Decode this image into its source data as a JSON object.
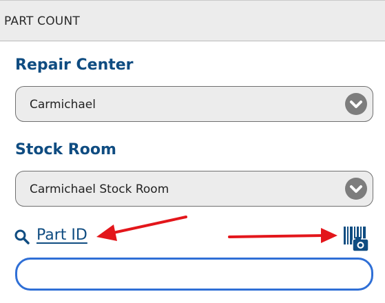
{
  "header": {
    "title": "PART COUNT"
  },
  "repair_center": {
    "label": "Repair Center",
    "selected": "Carmichael"
  },
  "stock_room": {
    "label": "Stock Room",
    "selected": "Carmichael Stock Room"
  },
  "part": {
    "label": "Part ID",
    "search_icon": "search-icon",
    "scan_icon": "barcode-camera-icon",
    "input_value": "",
    "input_placeholder": ""
  },
  "annotations": {
    "arrow_color": "#e3161b"
  },
  "colors": {
    "accent": "#0f4c81",
    "input_focus": "#2f6fd6",
    "header_bg": "#ececec"
  }
}
